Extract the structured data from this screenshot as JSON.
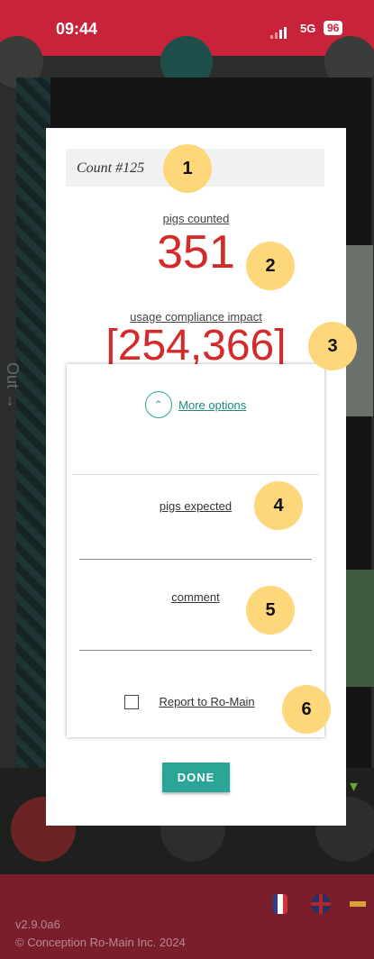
{
  "status_bar": {
    "time": "09:44",
    "network": "5G",
    "battery": "96"
  },
  "background_app": {
    "side_label": "Out →"
  },
  "modal": {
    "count_title": "Count #125",
    "pigs_counted_label": "pigs counted",
    "pigs_counted_value": "351",
    "compliance_label": "usage compliance impact",
    "compliance_value": "[254,366]",
    "more_options_label": "More options",
    "chevron_icon": "chevron-up-icon",
    "pigs_expected_label": "pigs expected",
    "comment_label": "comment",
    "report_label": "Report to Ro-Main",
    "report_checked": false,
    "done_label": "DONE"
  },
  "annotations": [
    "1",
    "2",
    "3",
    "4",
    "5",
    "6"
  ],
  "footer": {
    "version": "v2.9.0a6",
    "copyright": "© Conception Ro-Main Inc. 2024"
  },
  "colors": {
    "brand_red": "#c8233b",
    "value_red": "#d42a2a",
    "accent_teal": "#2aa596",
    "badge_yellow": "#fdd77a"
  }
}
